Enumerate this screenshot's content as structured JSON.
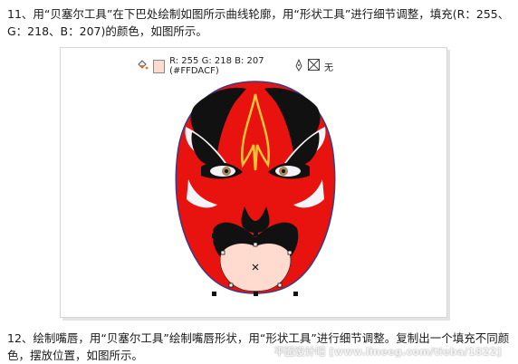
{
  "step11": {
    "text": "11、用“贝塞尔工具”在下巴处绘制如图所示曲线轮廓，用“形状工具”进行细节调整，填充(R：255、G：218、B：207)的颜色，如图所示。"
  },
  "fill_toolbar": {
    "color_readout": "R: 255 G: 218 B: 207 (#FFDACF)",
    "outline_value": "无",
    "fill_color": "#FFDACF",
    "icons": [
      "fill-bucket-icon",
      "pen-nib-icon",
      "no-outline-icon"
    ]
  },
  "mask": {
    "face_color": "#E8120E",
    "dark_color": "#111111",
    "white_color": "#F4F4F8",
    "gold_color": "#F3C437",
    "outline_color": "#3A3A8C",
    "chin_fill": "#FFDACF"
  },
  "step12": {
    "text": "12、绘制嘴唇，用“贝塞尔工具”绘制嘴唇形状，用“形状工具”进行细节调整。复制出一个填充不同颜色，摆放位置，如图所示。"
  },
  "watermark": {
    "text": "平面设计吧 [www.lineeg.com/tieba/1822]"
  }
}
